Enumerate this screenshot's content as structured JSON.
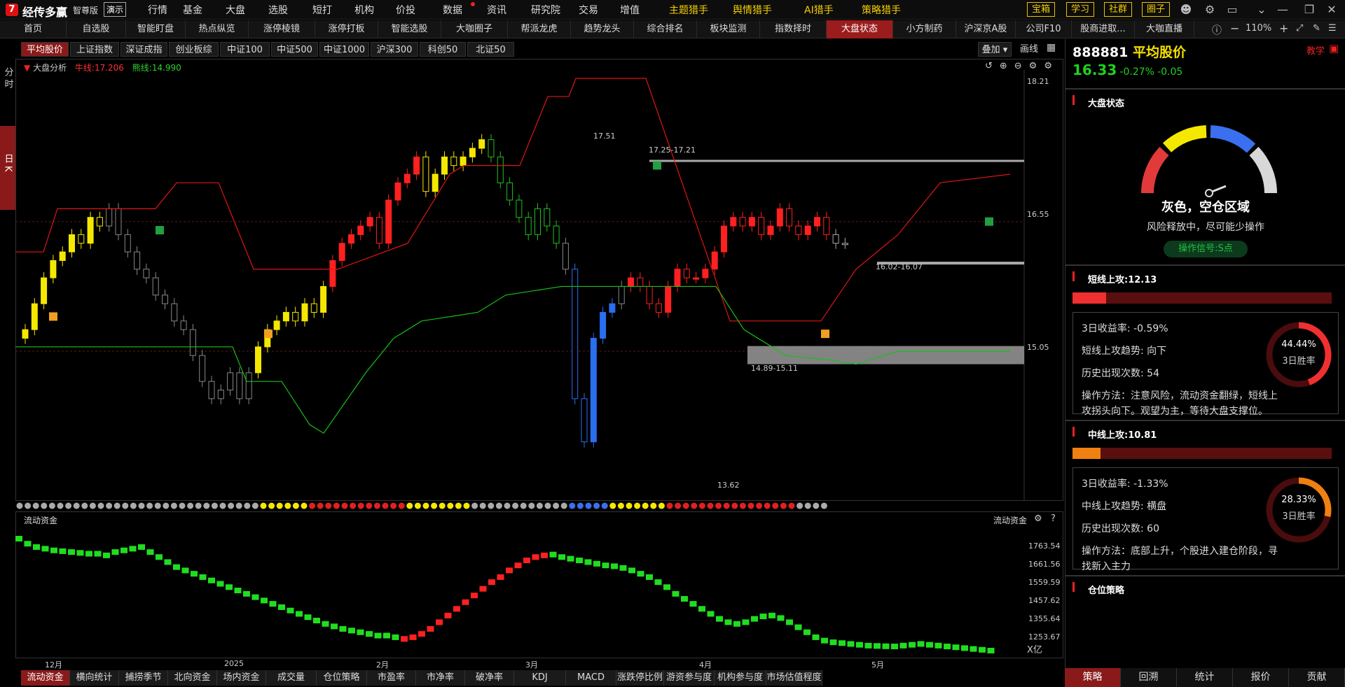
{
  "app": {
    "logo": "7",
    "name": "经传多赢",
    "edition": "智尊版",
    "demo": "演示"
  },
  "topmenu": [
    "行情",
    "基金",
    "大盘",
    "选股",
    "短打",
    "机构",
    "价投",
    "数据",
    "资讯",
    "研究院",
    "交易",
    "增值",
    "主题猎手",
    "舆情猎手",
    "AI猎手",
    "策略猎手"
  ],
  "topbuttons": [
    "宝箱",
    "学习",
    "社群",
    "圈子"
  ],
  "nav": [
    "首页",
    "自选股",
    "智能盯盘",
    "热点纵览",
    "涨停棱镜",
    "涨停打板",
    "智能选股",
    "大咖圈子",
    "帮派龙虎",
    "趋势龙头",
    "综合排名",
    "板块监测",
    "指数择时",
    "大盘状态",
    "小方制药",
    "沪深京A股",
    "公司F10",
    "股商进取...",
    "大咖直播"
  ],
  "zoom": "110%",
  "indextabs": [
    "平均股价",
    "上证指数",
    "深证成指",
    "创业板综",
    "中证100",
    "中证500",
    "中证1000",
    "沪深300",
    "科创50",
    "北证50"
  ],
  "chart_toolbar": {
    "overlay": "叠加",
    "draw": "画线"
  },
  "side": {
    "ft": "分时",
    "k": "日K"
  },
  "main_legend": {
    "name": "大盘分析",
    "niu_label": "牛线:17.206",
    "xiong_label": "熊线:14.990"
  },
  "price_axis": [
    "18.21",
    "16.55",
    "15.05"
  ],
  "annotations": {
    "high": "17.51",
    "range1": "17.25-17.21",
    "range2": "16.02-16.07",
    "range3": "14.89-15.11",
    "low": "13.62"
  },
  "sub_legend": "流动资金",
  "sub_axis": [
    "1763.54",
    "1661.56",
    "1559.59",
    "1457.62",
    "1355.64",
    "1253.67"
  ],
  "sub_unit": "X亿",
  "date_axis": [
    "12月",
    "2025",
    "2月",
    "3月",
    "4月",
    "5月"
  ],
  "bottomtabs": [
    "流动资金",
    "横向统计",
    "捕捞季节",
    "北向资金",
    "场内资金",
    "成交量",
    "仓位策略",
    "市盈率",
    "市净率",
    "破净率",
    "KDJ",
    "MACD",
    "涨跌停比例",
    "游资参与度",
    "机构参与度",
    "市场估值程度"
  ],
  "right": {
    "code": "888881",
    "name": "平均股价",
    "teach": "教学",
    "price": "16.33",
    "pct": "-0.27%",
    "chg": "-0.05",
    "state_title": "大盘状态",
    "state_text": "灰色，空仓区域",
    "state_desc": "风险释放中，尽可能少操作",
    "signal": "操作信号:S点",
    "short_title": "短线上攻:12.13",
    "short": {
      "ret": "3日收益率:  -0.59%",
      "trend": "短线上攻趋势:  向下",
      "count": "历史出现次数:  54",
      "method": "操作方法：注意风险，流动资金翻绿，短线上攻拐头向下。观望为主，等待大盘支撑位。",
      "winpct": "44.44%",
      "winlbl": "3日胜率"
    },
    "mid_title": "中线上攻:10.81",
    "mid": {
      "ret": "3日收益率:  -1.33%",
      "trend": "中线上攻趋势:  横盘",
      "count": "历史出现次数:  60",
      "method": "操作方法：底部上升，个股进入建仓阶段，寻找新入主力",
      "winpct": "28.33%",
      "winlbl": "3日胜率"
    },
    "pos_title": "仓位策略",
    "tabs": [
      "策略",
      "回溯",
      "统计",
      "报价",
      "贡献"
    ]
  },
  "colors": {
    "up": "#ff2020",
    "down": "#20c020",
    "yellow": "#f5e800",
    "accent": "#9b1c1c"
  }
}
